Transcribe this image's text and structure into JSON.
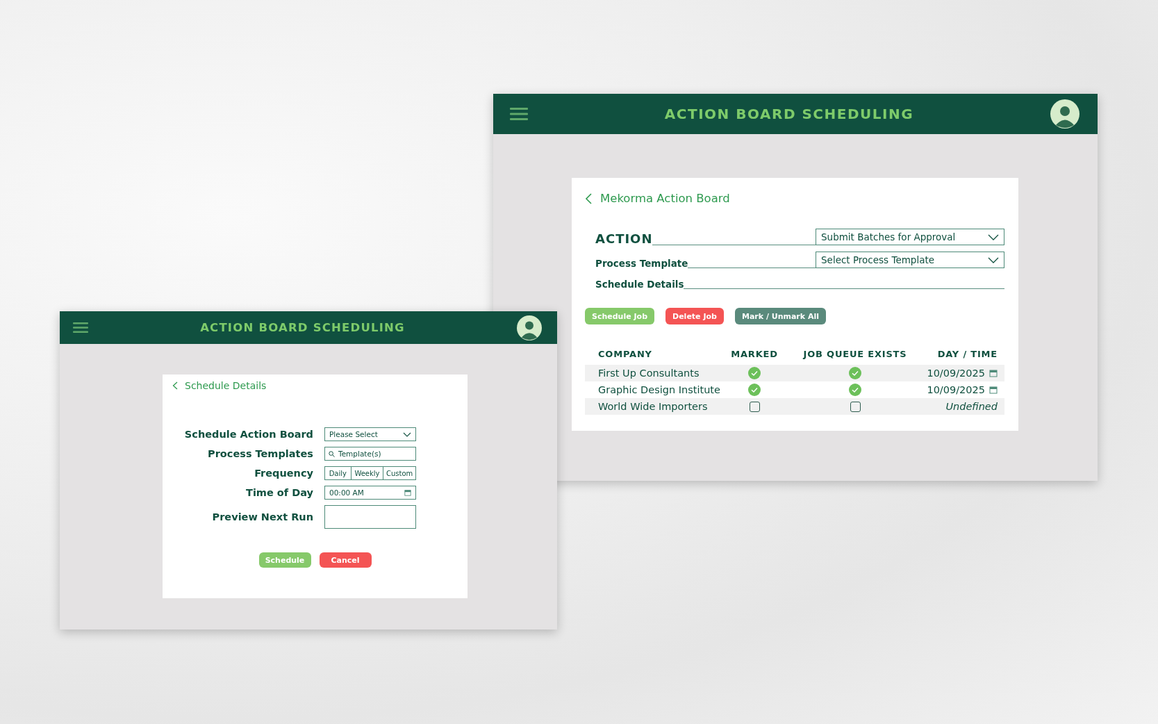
{
  "board_window": {
    "title": "ACTION BOARD SCHEDULING",
    "back_link": "Mekorma Action Board",
    "action": {
      "label": "ACTION",
      "value": "Submit Batches for Approval"
    },
    "process_template": {
      "label": "Process Template",
      "value": "Select Process Template"
    },
    "schedule_details_label": "Schedule Details",
    "buttons": [
      {
        "label": "Schedule Job",
        "color": "#86c96a"
      },
      {
        "label": "Delete Job",
        "color": "#f45454"
      },
      {
        "label": "Mark / Unmark All",
        "color": "#5a8a7c"
      }
    ],
    "table": {
      "columns": [
        "COMPANY",
        "MARKED",
        "JOB QUEUE EXISTS",
        "DAY / TIME"
      ],
      "rows": [
        {
          "company": "First Up Consultants",
          "marked": true,
          "job_queue_exists": true,
          "day_time": "10/09/2025",
          "scheduled": true
        },
        {
          "company": "Graphic Design Institute",
          "marked": true,
          "job_queue_exists": true,
          "day_time": "10/09/2025",
          "scheduled": true
        },
        {
          "company": "World Wide Importers",
          "marked": false,
          "job_queue_exists": false,
          "day_time": "Undefined",
          "scheduled": false
        }
      ]
    }
  },
  "schedule_window": {
    "title": "ACTION BOARD SCHEDULING",
    "back_link": "Schedule Details",
    "fields": [
      {
        "kind": "select",
        "label": "Schedule Action Board",
        "value": "Please Select"
      },
      {
        "kind": "search",
        "label": "Process Templates",
        "placeholder": "Template(s)"
      },
      {
        "kind": "segmented",
        "label": "Frequency",
        "options": [
          "Daily",
          "Weekly",
          "Custom"
        ]
      },
      {
        "kind": "time",
        "label": "Time of Day",
        "value": "00:00 AM"
      },
      {
        "kind": "textarea",
        "label": "Preview Next Run"
      }
    ],
    "buttons": [
      {
        "label": "Schedule",
        "color": "#86c96a"
      },
      {
        "label": "Cancel",
        "color": "#f45454"
      }
    ]
  }
}
